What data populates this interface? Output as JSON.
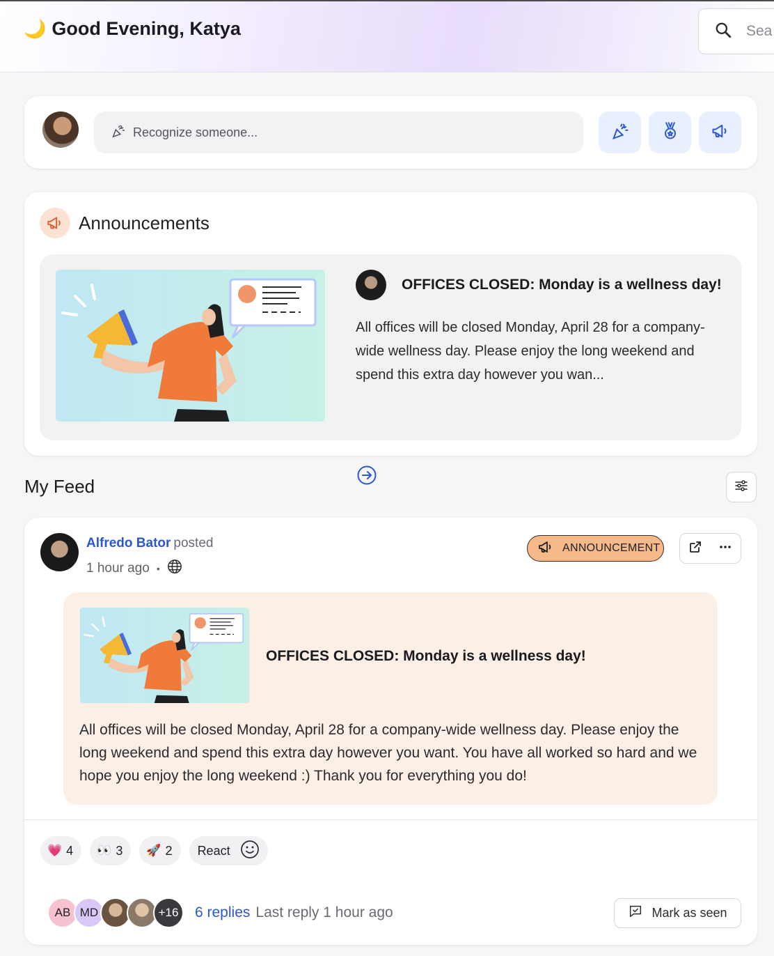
{
  "header": {
    "greeting_emoji": "🌙",
    "greeting": "Good Evening, Katya",
    "search_placeholder": "Sea"
  },
  "recognize": {
    "placeholder": "Recognize someone...",
    "buttons": [
      {
        "icon": "party-popper-icon"
      },
      {
        "icon": "medal-icon"
      },
      {
        "icon": "megaphone-icon"
      }
    ]
  },
  "announcements": {
    "title": "Announcements",
    "item": {
      "headline": "OFFICES CLOSED: Monday is a wellness day!",
      "body": "All offices will be closed Monday, April 28 for a company-wide wellness day. Please enjoy the long weekend and spend this extra day however you wan..."
    }
  },
  "feed": {
    "title": "My Feed",
    "post": {
      "author": "Alfredo Bator",
      "verb": "posted",
      "time": "1 hour ago",
      "separator": "•",
      "badge": "ANNOUNCEMENT",
      "headline": "OFFICES CLOSED: Monday is a wellness day!",
      "body": "All offices will be closed Monday, April 28 for a company-wide wellness day. Please enjoy the long weekend and spend this extra day however you want. You have all worked so hard and we hope you enjoy the long weekend :) Thank you for everything you do!",
      "reactions": [
        {
          "emoji": "💗",
          "count": "4"
        },
        {
          "emoji": "👀",
          "count": "3"
        },
        {
          "emoji": "🚀",
          "count": "2"
        }
      ],
      "react_label": "React",
      "reply_avatars": [
        {
          "initials": "AB",
          "color": "#f6c2cf"
        },
        {
          "initials": "MD",
          "color": "#d9c8f5"
        },
        {
          "initials": "",
          "color": "#7a6a5c"
        },
        {
          "initials": "",
          "color": "#9a8c80"
        },
        {
          "initials": "+16",
          "color": "#3a3a3e"
        }
      ],
      "replies_link": "6 replies",
      "last_reply": "Last reply 1 hour ago",
      "mark_seen": "Mark as seen"
    }
  },
  "colors": {
    "accent": "#2b57d4",
    "badge": "#f6b98a",
    "announcement_bg": "#fcefe6"
  }
}
